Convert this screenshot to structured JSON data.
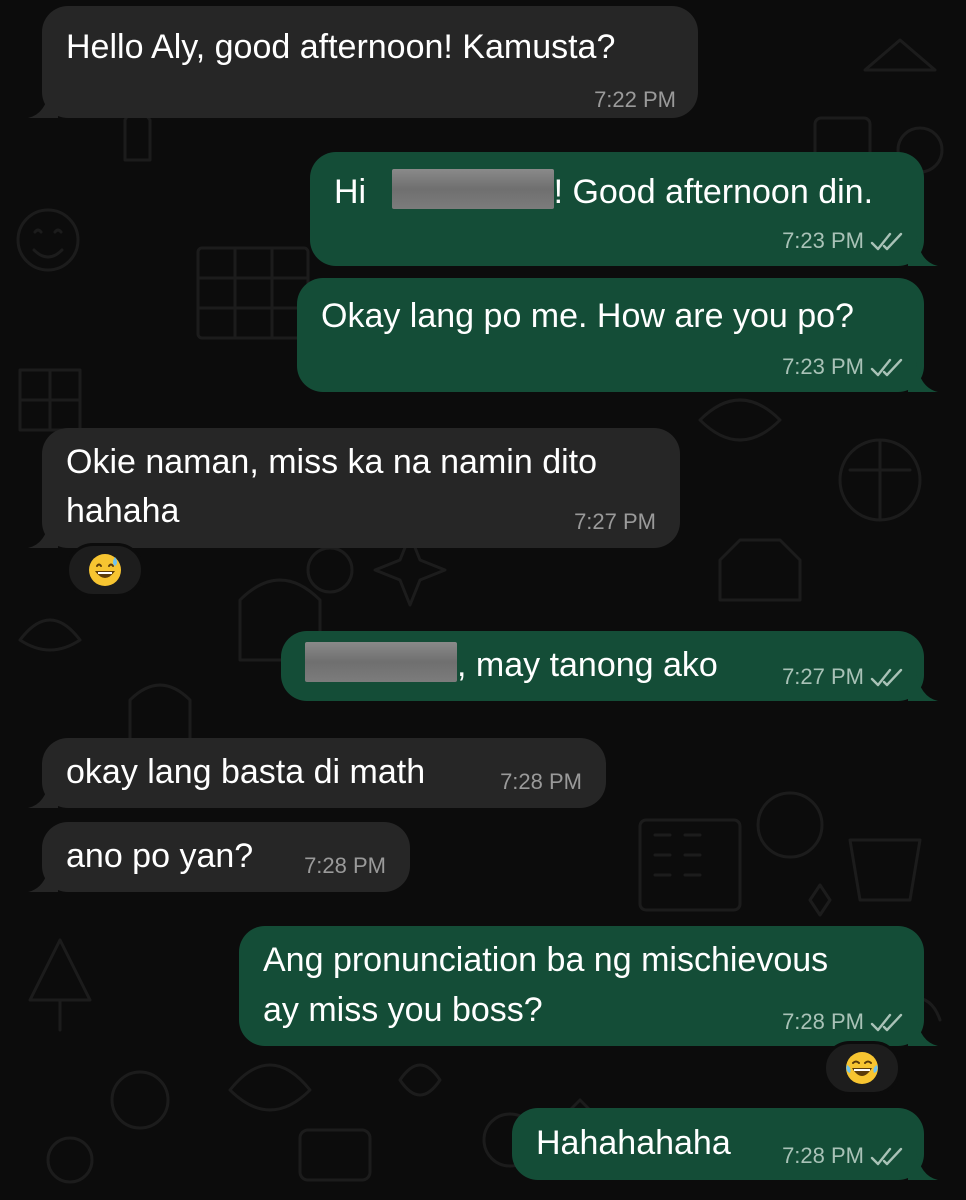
{
  "colors": {
    "background": "#0c0c0c",
    "incoming_bubble": "#262626",
    "outgoing_bubble": "#144d37",
    "timestamp_in": "#9a9a9a",
    "timestamp_out": "#a9c2b7",
    "read_ticks": "#a9c2b7"
  },
  "messages": [
    {
      "direction": "incoming",
      "text": "Hello Aly, good afternoon! Kamusta?",
      "time": "7:22 PM"
    },
    {
      "direction": "outgoing",
      "text_before": "Hi",
      "redacted": true,
      "text_after": "! Good afternoon din.",
      "time": "7:23 PM",
      "status": "read"
    },
    {
      "direction": "outgoing",
      "text": "Okay lang po me. How are you po?",
      "time": "7:23 PM",
      "status": "read"
    },
    {
      "direction": "incoming",
      "text_line1": "Okie naman, miss ka na namin dito",
      "text_line2": "hahaha",
      "time": "7:27 PM",
      "reaction": "grinning-face-with-sweat"
    },
    {
      "direction": "outgoing",
      "redacted": true,
      "text_after": ", may tanong ako",
      "time": "7:27 PM",
      "status": "read"
    },
    {
      "direction": "incoming",
      "text": "okay lang basta di math",
      "time": "7:28 PM"
    },
    {
      "direction": "incoming",
      "text": "ano po yan?",
      "time": "7:28 PM"
    },
    {
      "direction": "outgoing",
      "text_line1": "Ang pronunciation ba ng mischievous",
      "text_line2": "ay miss you boss?",
      "time": "7:28 PM",
      "status": "read",
      "reaction": "face-with-tears-of-joy"
    },
    {
      "direction": "outgoing",
      "text": "Hahahahaha",
      "time": "7:28 PM",
      "status": "read"
    }
  ]
}
